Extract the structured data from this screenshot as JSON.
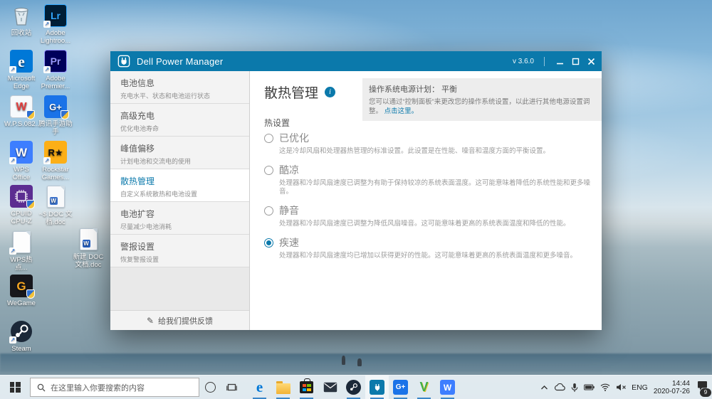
{
  "colors": {
    "dell_blue": "#0b79ab",
    "link_blue": "#0b79ab",
    "taskbar_bg": "#e5edf2",
    "edge_blue": "#0078d7"
  },
  "desktop": {
    "icons": [
      {
        "label": "回收站",
        "icon": "recycle-bin"
      },
      {
        "label": "Adobe Lightroo...",
        "icon": "lightroom",
        "glyph": "Lr"
      },
      {
        "label": "Microsoft Edge",
        "icon": "edge",
        "glyph": "e"
      },
      {
        "label": "Adobe Premier...",
        "icon": "premiere",
        "glyph": "Pr"
      },
      {
        "label": "W.P.S.082...",
        "icon": "wps-installer",
        "glyph": "W"
      },
      {
        "label": "腾讯手游助手",
        "icon": "gameloop",
        "glyph": "G+"
      },
      {
        "label": "WPS Office",
        "icon": "wps-office",
        "glyph": "W"
      },
      {
        "label": "Rockstar Games...",
        "icon": "rockstar-games",
        "glyph": "R★"
      },
      {
        "label": "CPUID CPU-Z",
        "icon": "cpu-z"
      },
      {
        "label": "~$ DOC 文档.doc",
        "icon": "word-temp-doc",
        "glyph": "W"
      },
      {
        "label": "WPS热点...",
        "icon": "blank-file"
      },
      {
        "label": "新建 DOC 文档.doc",
        "icon": "word-doc",
        "glyph": "W"
      },
      {
        "label": "WeGame",
        "icon": "wegame",
        "glyph": "G"
      },
      {
        "label": "Steam",
        "icon": "steam"
      }
    ]
  },
  "window": {
    "title": "Dell Power Manager",
    "version": "v 3.6.0",
    "sidebar": {
      "items": [
        {
          "title": "电池信息",
          "subtitle": "充电水平、状态和电池运行状态",
          "selected": false
        },
        {
          "title": "高级充电",
          "subtitle": "优化电池寿命",
          "selected": false
        },
        {
          "title": "峰值偏移",
          "subtitle": "计划电池和交流电的使用",
          "selected": false
        },
        {
          "title": "散热管理",
          "subtitle": "自定义系统散热和电池设置",
          "selected": true
        },
        {
          "title": "电池扩容",
          "subtitle": "尽量减少电池消耗",
          "selected": false
        },
        {
          "title": "警报设置",
          "subtitle": "恢复警报设置",
          "selected": false
        }
      ],
      "feedback_label": "给我们提供反馈",
      "feedback_glyph": "✎"
    },
    "main": {
      "heading": "散热管理",
      "info_glyph": "i",
      "notice": {
        "title": "操作系统电源计划： 平衡",
        "body": "您可以通过“控制面板”来更改您的操作系统设置，以此进行其他电源设置调整。",
        "link": "点击这里。"
      },
      "section_label": "热设置",
      "options": [
        {
          "label": "已优化",
          "desc": "这是冷却风扇和处理器热管理的标准设置。此设置是在性能、噪音和温度方面的平衡设置。",
          "selected": false
        },
        {
          "label": "酷凉",
          "desc": "处理器和冷却风扇速度已调整为有助于保持较凉的系统表面温度。这可能意味着降低的系统性能和更多噪音。",
          "selected": false
        },
        {
          "label": "静音",
          "desc": "处理器和冷却风扇速度已调整为降低风扇噪音。这可能意味着更高的系统表面温度和降低的性能。",
          "selected": false
        },
        {
          "label": "疾速",
          "desc": "处理器和冷却风扇速度均已增加以获得更好的性能。这可能意味着更高的系统表面温度和更多噪音。",
          "selected": true
        }
      ]
    }
  },
  "taskbar": {
    "search_placeholder": "在这里输入你要搜索的内容",
    "apps": [
      "edge",
      "file-explorer",
      "microsoft-store",
      "mail",
      "steam",
      "dell-power-manager",
      "gameloop",
      "v-app",
      "wps"
    ],
    "app_glyphs": {
      "edge": "e",
      "gameloop": "G+",
      "v_app": "V",
      "wps": "W"
    },
    "tray": {
      "language": "ENG",
      "time": "14:44",
      "date": "2020-07-26",
      "notification_count": "9"
    }
  }
}
